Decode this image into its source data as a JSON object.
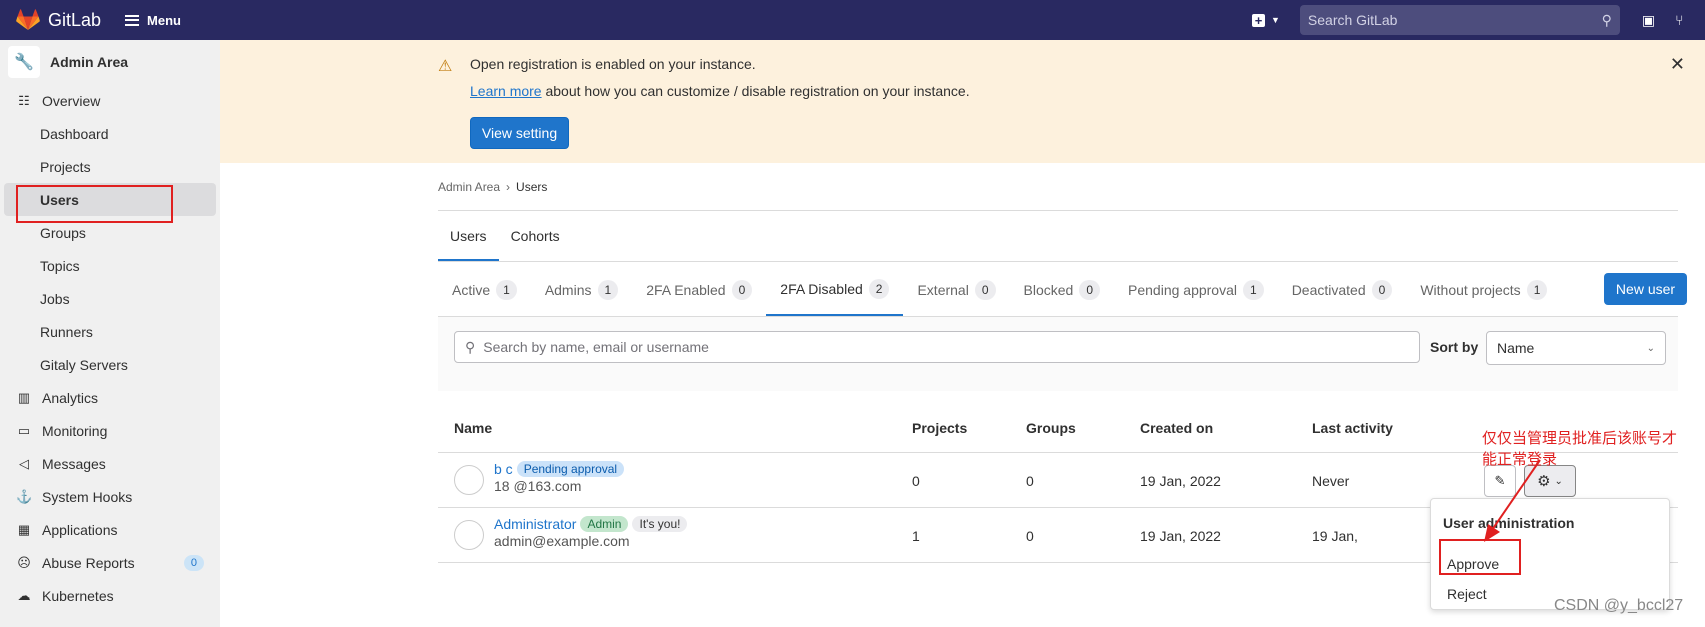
{
  "topbar": {
    "brand": "GitLab",
    "menu_label": "Menu",
    "search_placeholder": "Search GitLab"
  },
  "sidebar": {
    "title": "Admin Area",
    "items": [
      {
        "label": "Overview",
        "icon": "overview-icon"
      },
      {
        "label": "Dashboard"
      },
      {
        "label": "Projects"
      },
      {
        "label": "Users"
      },
      {
        "label": "Groups"
      },
      {
        "label": "Topics"
      },
      {
        "label": "Jobs"
      },
      {
        "label": "Runners"
      },
      {
        "label": "Gitaly Servers"
      },
      {
        "label": "Analytics",
        "icon": "chart-icon"
      },
      {
        "label": "Monitoring",
        "icon": "monitor-icon"
      },
      {
        "label": "Messages",
        "icon": "bullhorn-icon"
      },
      {
        "label": "System Hooks",
        "icon": "hook-icon"
      },
      {
        "label": "Applications",
        "icon": "applications-icon"
      },
      {
        "label": "Abuse Reports",
        "icon": "abuse-icon",
        "badge": "0"
      },
      {
        "label": "Kubernetes",
        "icon": "cloud-icon"
      }
    ]
  },
  "banner": {
    "title": "Open registration is enabled on your instance.",
    "learn_more": "Learn more",
    "desc_rest": " about how you can customize / disable registration on your instance.",
    "button": "View setting"
  },
  "breadcrumb": {
    "root": "Admin Area",
    "current": "Users"
  },
  "top_tabs": [
    "Users",
    "Cohorts"
  ],
  "filter_tabs": [
    {
      "label": "Active",
      "count": "1"
    },
    {
      "label": "Admins",
      "count": "1"
    },
    {
      "label": "2FA Enabled",
      "count": "0"
    },
    {
      "label": "2FA Disabled",
      "count": "2"
    },
    {
      "label": "External",
      "count": "0"
    },
    {
      "label": "Blocked",
      "count": "0"
    },
    {
      "label": "Pending approval",
      "count": "1"
    },
    {
      "label": "Deactivated",
      "count": "0"
    },
    {
      "label": "Without projects",
      "count": "1"
    }
  ],
  "new_user": "New user",
  "search": {
    "placeholder": "Search by name, email or username",
    "sort_label": "Sort by",
    "sort_value": "Name"
  },
  "table": {
    "headers": [
      "Name",
      "Projects",
      "Groups",
      "Created on",
      "Last activity"
    ],
    "rows": [
      {
        "name": "b c",
        "badges": [
          "Pending approval"
        ],
        "email": "18          @163.com",
        "projects": "0",
        "groups": "0",
        "created": "19 Jan, 2022",
        "last": "Never"
      },
      {
        "name": "Administrator",
        "badges": [
          "Admin",
          "It's you!"
        ],
        "email": "admin@example.com",
        "projects": "1",
        "groups": "0",
        "created": "19 Jan, 2022",
        "last": "19 Jan,"
      }
    ]
  },
  "dropdown": {
    "header": "User administration",
    "items": [
      "Approve",
      "Reject"
    ]
  },
  "annotation": "仅仅当管理员批准后该账号才能正常登录",
  "watermark": "CSDN @y_bccl27"
}
